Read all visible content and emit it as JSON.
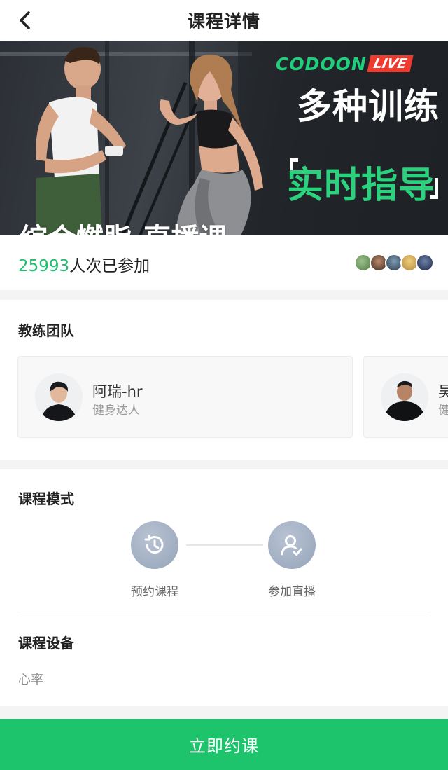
{
  "header": {
    "title": "课程详情",
    "back_icon": "chevron-left-icon"
  },
  "banner": {
    "brand_main": "CODOON",
    "brand_badge": "LIVE",
    "tagline_1": "多种训练",
    "tagline_2": "实时指导",
    "course_name": "综合燃脂-直播课",
    "colors": {
      "brand_green": "#1fcf7c",
      "badge_red": "#ef3b2d",
      "tagline_green": "#2bd17d"
    }
  },
  "participants": {
    "count": "25993",
    "suffix": "人次已参加"
  },
  "coaches": {
    "title": "教练团队",
    "items": [
      {
        "name": "阿瑞-hr",
        "role": "健身达人"
      },
      {
        "name": "吴",
        "role": "健"
      }
    ]
  },
  "mode": {
    "title": "课程模式",
    "steps": [
      {
        "label": "预约课程",
        "icon": "clock-history-icon"
      },
      {
        "label": "参加直播",
        "icon": "user-check-icon"
      }
    ]
  },
  "equipment": {
    "title": "课程设备",
    "value": "心率"
  },
  "footer": {
    "button_label": "立即约课",
    "color": "#1ec46c"
  }
}
